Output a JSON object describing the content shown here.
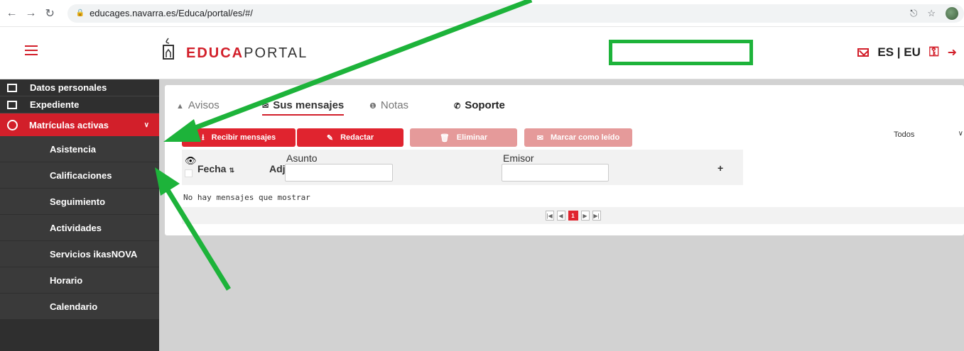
{
  "browser": {
    "url": "educages.navarra.es/Educa/portal/es/#/"
  },
  "header": {
    "brand_bold": "EDUCA",
    "brand_light": "PORTAL",
    "lang": "ES | EU"
  },
  "sidebar": {
    "items": [
      {
        "label": "Datos personales"
      },
      {
        "label": "Expediente"
      },
      {
        "label": "Matrículas activas"
      }
    ],
    "sub_items": [
      {
        "label": "Asistencia"
      },
      {
        "label": "Calificaciones"
      },
      {
        "label": "Seguimiento"
      },
      {
        "label": "Actividades"
      },
      {
        "label": "Servicios ikasNOVA"
      },
      {
        "label": "Horario"
      },
      {
        "label": "Calendario"
      }
    ]
  },
  "tabs": {
    "avisos": "Avisos",
    "mensajes": "Sus mensajes",
    "notas": "Notas",
    "soporte": "Soporte"
  },
  "toolbar": {
    "recibir": "Recibir mensajes",
    "redactar": "Redactar",
    "eliminar": "Eliminar",
    "marcar": "Marcar como leído",
    "filter": "Todos"
  },
  "table": {
    "col_fecha": "Fecha",
    "col_adj": "Adj.",
    "col_asunto": "Asunto",
    "col_emisor": "Emisor",
    "plus": "+",
    "empty": "No hay mensajes que mostrar",
    "current_page": "1"
  },
  "colors": {
    "accent": "#d21f2a",
    "highlight": "#1db33a",
    "sidebar": "#2f2f2f"
  }
}
